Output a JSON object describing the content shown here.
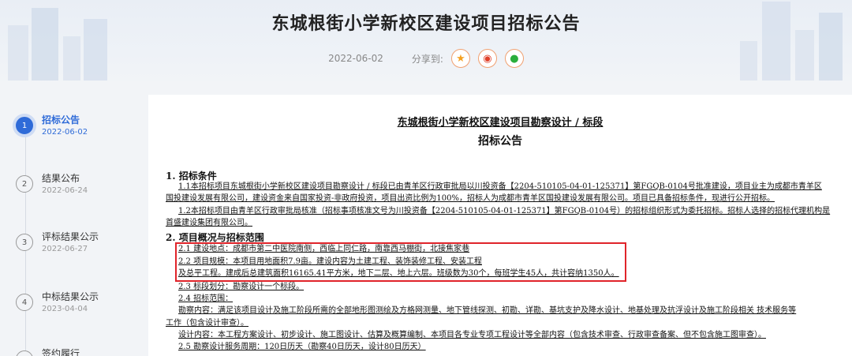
{
  "header": {
    "title": "东城根街小学新校区建设项目招标公告",
    "date": "2022-06-02",
    "share_label": "分享到:",
    "share_icons": [
      "favorite-icon",
      "weibo-icon",
      "wechat-icon"
    ]
  },
  "timeline": {
    "items": [
      {
        "num": "1",
        "label": "招标公告",
        "date": "2022-06-02",
        "active": true
      },
      {
        "num": "2",
        "label": "结果公布",
        "date": "2022-06-24",
        "active": false
      },
      {
        "num": "3",
        "label": "评标结果公示",
        "date": "2022-06-27",
        "active": false
      },
      {
        "num": "4",
        "label": "中标结果公示",
        "date": "2023-04-04",
        "active": false
      },
      {
        "num": "5",
        "label": "签约履行",
        "date": "",
        "active": false
      }
    ]
  },
  "document": {
    "title": "东城根街小学新校区建设项目勘察设计 / 标段",
    "subtitle": "招标公告",
    "sec1": "1. 招标条件",
    "l1": "1.1本招标项目东城根街小学新校区建设项目勘察设计 / 标段已由青羊区行政审批局以川投资备【2204-510105-04-01-125371】第FGQB-0104号批准建设，项目业主为成都市青羊区",
    "l2": "国投建设发展有限公司，建设资金来自国家投资-非政府投资，项目出资比例为100%，招标人为成都市青羊区国投建设发展有限公司。项目已具备招标条件，现进行公开招标。",
    "l3": "1.2本招标项目由青羊区行政审批局核准（招标事项核准文号为川投资备【2204-510105-04-01-125371】第FGQB-0104号）的招标组织形式为委托招标。招标人选择的招标代理机构是",
    "l4": "首盛建设集团有限公司。",
    "sec2": "2. 项目概况与招标范围",
    "l5": "2.1 建设地点：成都市第二中医院南侧，西临上同仁路，南靠西马棚街，北接焦家巷",
    "l6": "2.2 项目规模：本项目用地面积7.9亩。建设内容为土建工程、装饰装修工程、安装工程",
    "l7": "及总平工程。建成后总建筑面积16165.41平方米，地下二层、地上六层。班级数为30个，每班学生45人，共计容纳1350人。",
    "l8": "2.3 标段划分：勘察设计一个标段。",
    "l9": "2.4 招标范围：",
    "l10": "勘察内容：满足该项目设计及施工阶段所需的全部地形图测绘及方格网测量、地下管线探测、初勘、详勘、基坑支护及降水设计、地基处理及抗浮设计及施工阶段相关 技术服务等",
    "l11": "工作（包含设计审查）。",
    "l12": "设计内容：本工程方案设计、初步设计、施工图设计、估算及概算编制、本项目各专业专项工程设计等全部内容（包含技术审查、行政审查备案、但不包含施工图审查）。",
    "l13": "2.5 勘察设计服务周期：120日历天（勘察40日历天，设计80日历天）"
  }
}
